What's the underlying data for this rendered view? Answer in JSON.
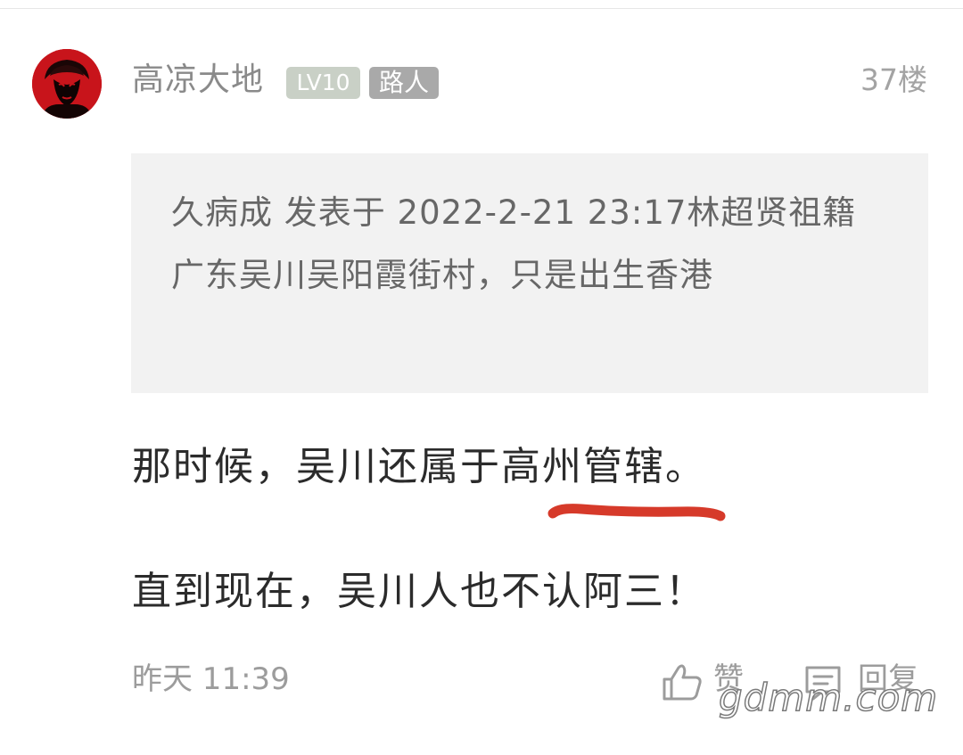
{
  "post": {
    "username": "高凉大地",
    "level_badge": "LV10",
    "role_badge": "路人",
    "floor": "37楼"
  },
  "quote": {
    "text": "久病成 发表于 2022-2-21 23:17林超贤祖籍广东吴川吴阳霞街村，只是出生香港"
  },
  "content": {
    "line1": "那时候，吴川还属于高州管辖。",
    "line2": "直到现在，吴川人也不认阿三！"
  },
  "footer": {
    "time": "昨天 11:39",
    "like_label": "赞",
    "reply_label": "回复"
  },
  "watermark": "gdmm.com",
  "colors": {
    "username": "#8a8a8a",
    "level_badge_bg": "#c9d0c6",
    "role_badge_bg": "#a9a9a9",
    "quote_bg": "#f2f2f2",
    "annotation_red": "#d63a2a"
  },
  "icons": [
    "thumbs-up-icon",
    "comment-icon"
  ]
}
